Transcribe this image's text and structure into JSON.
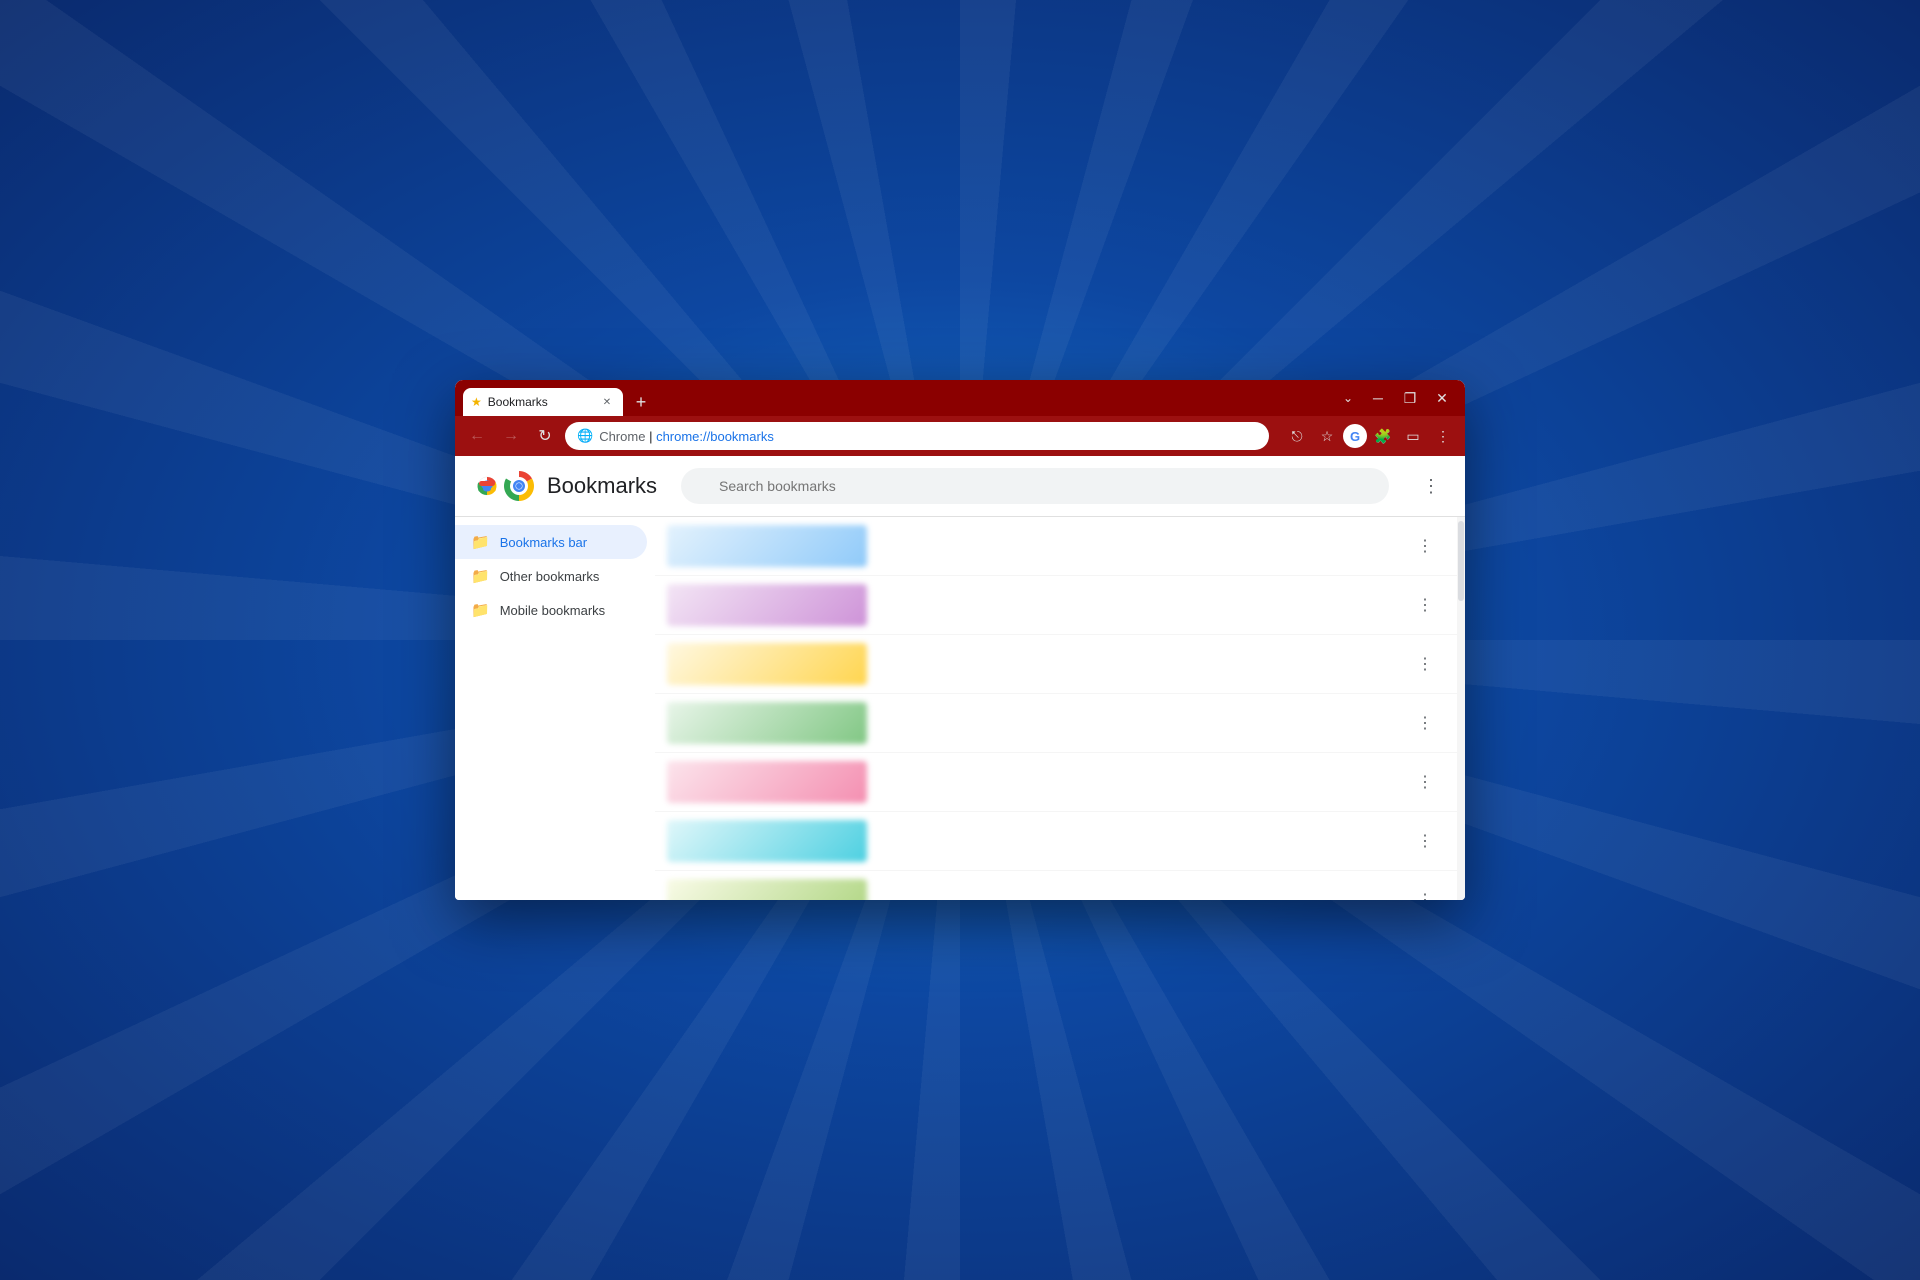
{
  "background": {
    "color": "#1565c0"
  },
  "window": {
    "title": "Bookmarks",
    "tab": {
      "label": "Bookmarks",
      "favicon": "★"
    },
    "controls": {
      "dropdown": "⌄",
      "minimize": "─",
      "maximize": "❐",
      "close": "✕"
    }
  },
  "addressbar": {
    "back_label": "←",
    "forward_label": "→",
    "refresh_label": "↻",
    "url_chrome": "Chrome",
    "url_separator": " | ",
    "url_path": "chrome://bookmarks",
    "share_icon": "⎋",
    "bookmark_icon": "☆",
    "extension_icon": "⚙",
    "sidebar_icon": "▭",
    "more_icon": "⋮"
  },
  "page": {
    "title": "Bookmarks",
    "search_placeholder": "Search bookmarks",
    "more_icon": "⋮"
  },
  "sidebar": {
    "items": [
      {
        "id": "bookmarks-bar",
        "label": "Bookmarks bar",
        "active": true
      },
      {
        "id": "other-bookmarks",
        "label": "Other bookmarks",
        "active": false
      },
      {
        "id": "mobile-bookmarks",
        "label": "Mobile bookmarks",
        "active": false
      }
    ]
  },
  "bookmarks": {
    "items": [
      {
        "id": 1,
        "thumb_class": "thumb-1"
      },
      {
        "id": 2,
        "thumb_class": "thumb-2"
      },
      {
        "id": 3,
        "thumb_class": "thumb-3"
      },
      {
        "id": 4,
        "thumb_class": "thumb-4"
      },
      {
        "id": 5,
        "thumb_class": "thumb-5"
      },
      {
        "id": 6,
        "thumb_class": "thumb-6"
      },
      {
        "id": 7,
        "thumb_class": "thumb-7"
      },
      {
        "id": 8,
        "thumb_class": "thumb-8"
      },
      {
        "id": 9,
        "thumb_class": "thumb-9"
      },
      {
        "id": 10,
        "thumb_class": "thumb-10"
      },
      {
        "id": 11,
        "thumb_class": "thumb-11"
      },
      {
        "id": 12,
        "thumb_class": "thumb-12"
      }
    ],
    "dots_label": "⋮"
  }
}
